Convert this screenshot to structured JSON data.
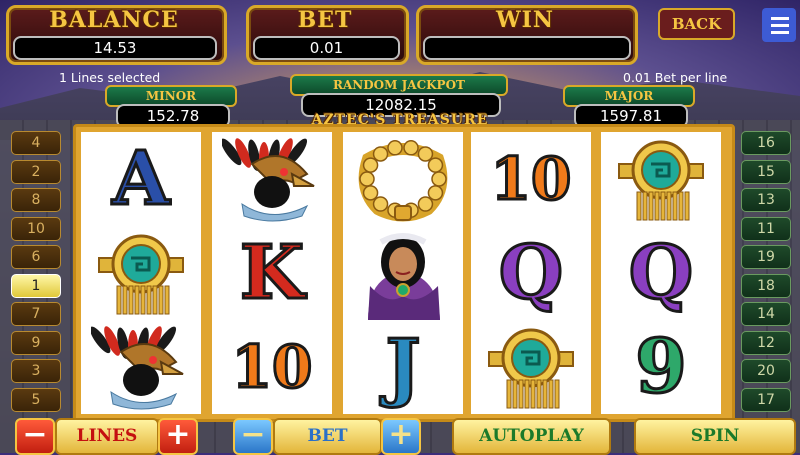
{
  "header": {
    "balance_label": "BALANCE",
    "balance_value": "14.53",
    "bet_label": "BET",
    "bet_value": "0.01",
    "win_label": "WIN",
    "win_value": "",
    "back_label": "BACK"
  },
  "info": {
    "lines_selected": "1 Lines selected",
    "bet_per_line": "0.01 Bet per line"
  },
  "jackpots": {
    "minor_label": "MINOR",
    "minor_value": "152.78",
    "random_label": "RANDOM JACKPOT",
    "random_value": "12082.15",
    "major_label": "MAJOR",
    "major_value": "1597.81"
  },
  "game_title": "AZTEC'S TREASURE",
  "left_lines": [
    "4",
    "2",
    "8",
    "10",
    "6",
    "1",
    "7",
    "9",
    "3",
    "5"
  ],
  "right_lines": [
    "16",
    "15",
    "13",
    "11",
    "19",
    "18",
    "14",
    "12",
    "20",
    "17"
  ],
  "active_line": "1",
  "reels": [
    [
      "A",
      "medallion",
      "eagle-headdress"
    ],
    [
      "eagle-headdress",
      "K",
      "10"
    ],
    [
      "necklace",
      "aztec-princess",
      "J"
    ],
    [
      "10",
      "Q",
      "medallion"
    ],
    [
      "medallion",
      "Q",
      "9"
    ]
  ],
  "symbol_text": {
    "A": "A",
    "K": "K",
    "Q": "Q",
    "J": "J",
    "10": "10",
    "9": "9"
  },
  "controls": {
    "lines_label": "LINES",
    "bet_label": "BET",
    "autoplay_label": "AUTOPLAY",
    "spin_label": "SPIN"
  },
  "colors": {
    "A": "#2a4fa8",
    "K": "#d42a1e",
    "Q": "#8a3fc0",
    "J": "#2a8abf",
    "10": "#f07a1a",
    "9": "#2ea86a",
    "gold": "#f5c542"
  }
}
